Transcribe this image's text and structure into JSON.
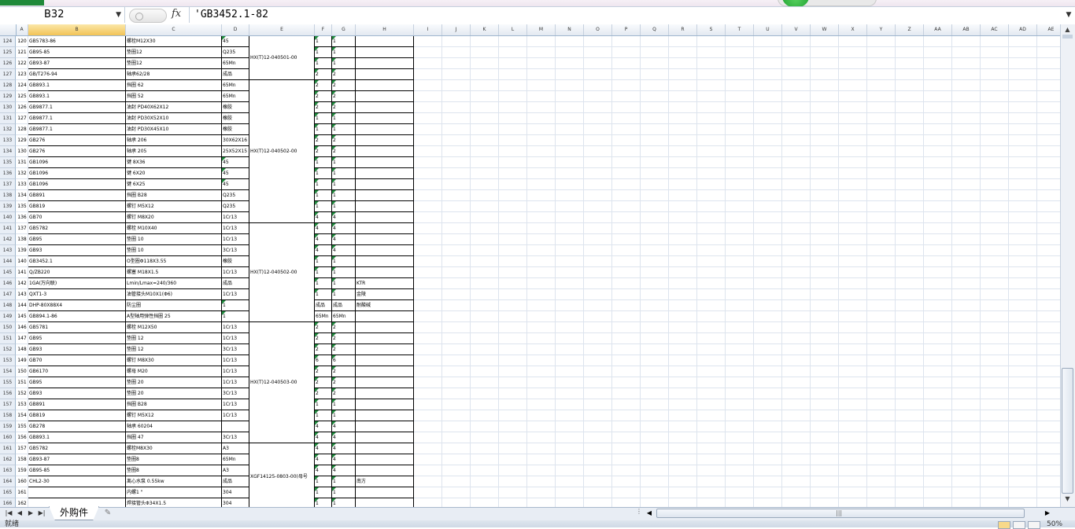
{
  "name_box": "B32",
  "fx_label": "fx",
  "formula_value": "'GB3452.1-82",
  "sheet_tab": "外购件",
  "status_text": "就绪",
  "zoom": "50%",
  "selected_column": "B",
  "columns": [
    "B",
    "C",
    "D",
    "E",
    "F",
    "G",
    "H",
    "I",
    "J",
    "K",
    "L",
    "M",
    "N",
    "O",
    "P",
    "Q",
    "R",
    "S",
    "T",
    "U",
    "V",
    "W",
    "X",
    "Y",
    "Z",
    "AA",
    "AB",
    "AC",
    "AD",
    "AE"
  ],
  "col_a": "A",
  "rows": [
    {
      "r": "124",
      "a": "120",
      "b": "GB5783-86",
      "c": "螺栓M12X30",
      "d": "45",
      "f": "1",
      "g": "1",
      "h": ""
    },
    {
      "r": "125",
      "a": "121",
      "b": "GB95-85",
      "c": "垫圈12",
      "d": "Q235",
      "f": "1",
      "g": "1",
      "h": ""
    },
    {
      "r": "126",
      "a": "122",
      "b": "GB93-87",
      "c": "垫圈12",
      "d": "65Mn",
      "f": "1",
      "g": "1",
      "h": ""
    },
    {
      "r": "127",
      "a": "123",
      "b": "GB/T276-94",
      "c": "轴承62/28",
      "d": "成品",
      "f": "2",
      "g": "2",
      "h": ""
    },
    {
      "r": "128",
      "a": "124",
      "b": "GB893.1",
      "c": "挡圈 62",
      "d": "65Mn",
      "f": "2",
      "g": "2",
      "h": ""
    },
    {
      "r": "129",
      "a": "125",
      "b": "GB893.1",
      "c": "挡圈 52",
      "d": "65Mn",
      "f": "2",
      "g": "2",
      "h": ""
    },
    {
      "r": "130",
      "a": "126",
      "b": "GB9877.1",
      "c": "油封 PD40X62X12",
      "d": "橡胶",
      "f": "2",
      "g": "2",
      "h": ""
    },
    {
      "r": "131",
      "a": "127",
      "b": "GB9877.1",
      "c": "油封 PD30X52X10",
      "d": "橡胶",
      "f": "1",
      "g": "1",
      "h": ""
    },
    {
      "r": "132",
      "a": "128",
      "b": "GB9877.1",
      "c": "油封 PD30X45X10",
      "d": "橡胶",
      "f": "1",
      "g": "1",
      "h": ""
    },
    {
      "r": "133",
      "a": "129",
      "b": "GB276",
      "c": "轴承 206",
      "d": "30X62X16",
      "f": "2",
      "g": "2",
      "h": ""
    },
    {
      "r": "134",
      "a": "130",
      "b": "GB276",
      "c": "轴承 205",
      "d": "25X52X15",
      "f": "2",
      "g": "2",
      "h": ""
    },
    {
      "r": "135",
      "a": "131",
      "b": "GB1096",
      "c": "键 8X36",
      "d": "45",
      "f": "1",
      "g": "1",
      "h": ""
    },
    {
      "r": "136",
      "a": "132",
      "b": "GB1096",
      "c": "键 6X20",
      "d": "45",
      "f": "1",
      "g": "1",
      "h": ""
    },
    {
      "r": "137",
      "a": "133",
      "b": "GB1096",
      "c": "键 6X25",
      "d": "45",
      "f": "1",
      "g": "1",
      "h": ""
    },
    {
      "r": "138",
      "a": "134",
      "b": "GB891",
      "c": "挡圈 B28",
      "d": "Q235",
      "f": "1",
      "g": "1",
      "h": ""
    },
    {
      "r": "139",
      "a": "135",
      "b": "GB819",
      "c": "螺钉 M5X12",
      "d": "Q235",
      "f": "1",
      "g": "1",
      "h": ""
    },
    {
      "r": "140",
      "a": "136",
      "b": "GB70",
      "c": "螺钉 M8X20",
      "d": "1Cr13",
      "f": "4",
      "g": "4",
      "h": ""
    },
    {
      "r": "141",
      "a": "137",
      "b": "GB5782",
      "c": "螺栓 M10X40",
      "d": "1Cr13",
      "f": "4",
      "g": "4",
      "h": ""
    },
    {
      "r": "142",
      "a": "138",
      "b": "GB95",
      "c": "垫圈 10",
      "d": "1Cr13",
      "f": "4",
      "g": "4",
      "h": ""
    },
    {
      "r": "143",
      "a": "139",
      "b": "GB93",
      "c": "垫圈 10",
      "d": "3Cr13",
      "f": "4",
      "g": "4",
      "h": ""
    },
    {
      "r": "144",
      "a": "140",
      "b": "GB3452.1",
      "c": "O型圈Φ118X3.55",
      "d": "橡胶",
      "f": "1",
      "g": "1",
      "h": ""
    },
    {
      "r": "145",
      "a": "141",
      "b": "Q/ZB220",
      "c": "螺塞 M18X1.5",
      "d": "1Cr13",
      "f": "1",
      "g": "1",
      "h": ""
    },
    {
      "r": "146",
      "a": "142",
      "b": "1GA(万向联)",
      "c": "Lmin/Lmax=240/360",
      "d": "成品",
      "f": "1",
      "g": "1",
      "h": "KTR"
    },
    {
      "r": "147",
      "a": "143",
      "b": "QXT1-3",
      "c": "油管接头M10X1(Φ6)",
      "d": "1Cr13",
      "f": "1",
      "g": "1",
      "h": "金陵"
    },
    {
      "r": "148",
      "a": "144",
      "b": "DHP-80X88X4",
      "c": "防尘圈",
      "d": "1",
      "f": "成品",
      "g": "成品",
      "h": "耐酸碱"
    },
    {
      "r": "149",
      "a": "145",
      "b": "GB894.1-86",
      "c": "A型轴用弹性挡圈 25",
      "d": "1",
      "f": "65Mn",
      "g": "65Mn",
      "h": ""
    },
    {
      "r": "150",
      "a": "146",
      "b": "GB5781",
      "c": "螺栓 M12X50",
      "d": "1Cr13",
      "f": "2",
      "g": "2",
      "h": ""
    },
    {
      "r": "151",
      "a": "147",
      "b": "GB95",
      "c": "垫圈 12",
      "d": "1Cr13",
      "f": "2",
      "g": "2",
      "h": ""
    },
    {
      "r": "152",
      "a": "148",
      "b": "GB93",
      "c": "垫圈 12",
      "d": "3Cr13",
      "f": "2",
      "g": "2",
      "h": ""
    },
    {
      "r": "153",
      "a": "149",
      "b": "GB70",
      "c": "螺钉 M8X30",
      "d": "1Cr13",
      "f": "6",
      "g": "6",
      "h": ""
    },
    {
      "r": "154",
      "a": "150",
      "b": "GB6170",
      "c": "螺母 M20",
      "d": "1Cr13",
      "f": "2",
      "g": "2",
      "h": ""
    },
    {
      "r": "155",
      "a": "151",
      "b": "GB95",
      "c": "垫圈 20",
      "d": "1Cr13",
      "f": "2",
      "g": "2",
      "h": ""
    },
    {
      "r": "156",
      "a": "152",
      "b": "GB93",
      "c": "垫圈 20",
      "d": "3Cr13",
      "f": "2",
      "g": "2",
      "h": ""
    },
    {
      "r": "157",
      "a": "153",
      "b": "GB891",
      "c": "挡圈 B28",
      "d": "1Cr13",
      "f": "1",
      "g": "1",
      "h": ""
    },
    {
      "r": "158",
      "a": "154",
      "b": "GB819",
      "c": "螺钉 M5X12",
      "d": "1Cr13",
      "f": "1",
      "g": "1",
      "h": ""
    },
    {
      "r": "159",
      "a": "155",
      "b": "GB278",
      "c": "轴承 60204",
      "d": "",
      "f": "4",
      "g": "4",
      "h": ""
    },
    {
      "r": "160",
      "a": "156",
      "b": "GB893.1",
      "c": "挡圈 47",
      "d": "3Cr13",
      "f": "4",
      "g": "4",
      "h": ""
    },
    {
      "r": "161",
      "a": "157",
      "b": "GB5782",
      "c": "螺栓M8X30",
      "d": "A3",
      "f": "4",
      "g": "4",
      "h": ""
    },
    {
      "r": "162",
      "a": "158",
      "b": "GB93-87",
      "c": "垫圈8",
      "d": "65Mn",
      "f": "4",
      "g": "4",
      "h": ""
    },
    {
      "r": "163",
      "a": "159",
      "b": "GB95-85",
      "c": "垫圈8",
      "d": "A3",
      "f": "4",
      "g": "4",
      "h": ""
    },
    {
      "r": "164",
      "a": "160",
      "b": "CHL2-30",
      "c": "离心水泵 0.55kw",
      "d": "成品",
      "f": "1",
      "g": "1",
      "h": "南方"
    },
    {
      "r": "165",
      "a": "161",
      "b": "",
      "c": "内螺1 \"",
      "d": "304",
      "f": "1",
      "g": "1",
      "h": ""
    },
    {
      "r": "166",
      "a": "162",
      "b": "",
      "c": "焊接管头Φ34X1.5",
      "d": "304",
      "f": "1",
      "g": "1",
      "h": ""
    }
  ],
  "merged_e": [
    {
      "text": "HX(T)12-040501-00"
    },
    {
      "text": "HX(T)12-040502-00"
    },
    {
      "text": "HX(T)12-040502-00"
    },
    {
      "text": "HX(T)12-040503-00"
    },
    {
      "text": "XGF14125-0803-00(母号"
    }
  ]
}
